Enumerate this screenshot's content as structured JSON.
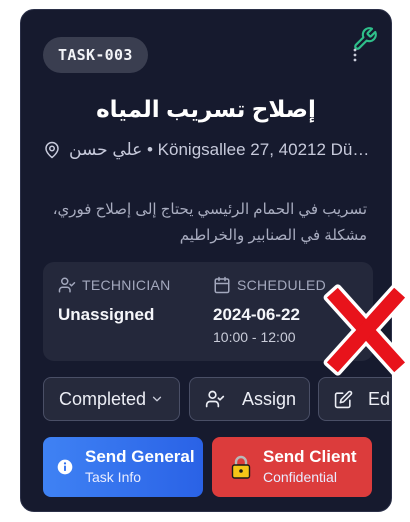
{
  "task": {
    "id": "TASK-003",
    "title": "إصلاح تسريب المياه",
    "address": "علي حسن • Königsallee 27, 40212 Düs...",
    "description_line1": "تسريب في الحمام الرئيسي يحتاج إلى إصلاح فوري،",
    "description_line2": "مشكلة في الصنابير والخراطيم"
  },
  "info": {
    "technician_label": "TECHNICIAN",
    "technician_value": "Unassigned",
    "scheduled_label": "SCHEDULED",
    "scheduled_date": "2024-06-22",
    "scheduled_time": "10:00 - 12:00"
  },
  "buttons": {
    "status_label": "Completed",
    "assign_label": "Assign",
    "edit_label": "Edi"
  },
  "actions": {
    "general_main": "Send General",
    "general_sub": "Task Info",
    "client_main": "Send Client",
    "client_sub": "Confidential"
  },
  "icons": {
    "wrench": "wrench-icon",
    "menu": "kebab-menu-icon",
    "location": "map-pin-icon",
    "technician": "user-check-icon",
    "calendar": "calendar-icon",
    "chevron": "chevron-down-icon",
    "assign": "user-check-icon",
    "edit": "edit-icon",
    "info": "info-icon",
    "lock": "lock-icon",
    "overlay": "red-x-mark"
  },
  "colors": {
    "card_bg": "#161a2e",
    "accent_green": "#2fbf8a",
    "general_blue": "#3f82f4",
    "client_red": "#dc3c3c",
    "overlay_red": "#e8131b"
  }
}
